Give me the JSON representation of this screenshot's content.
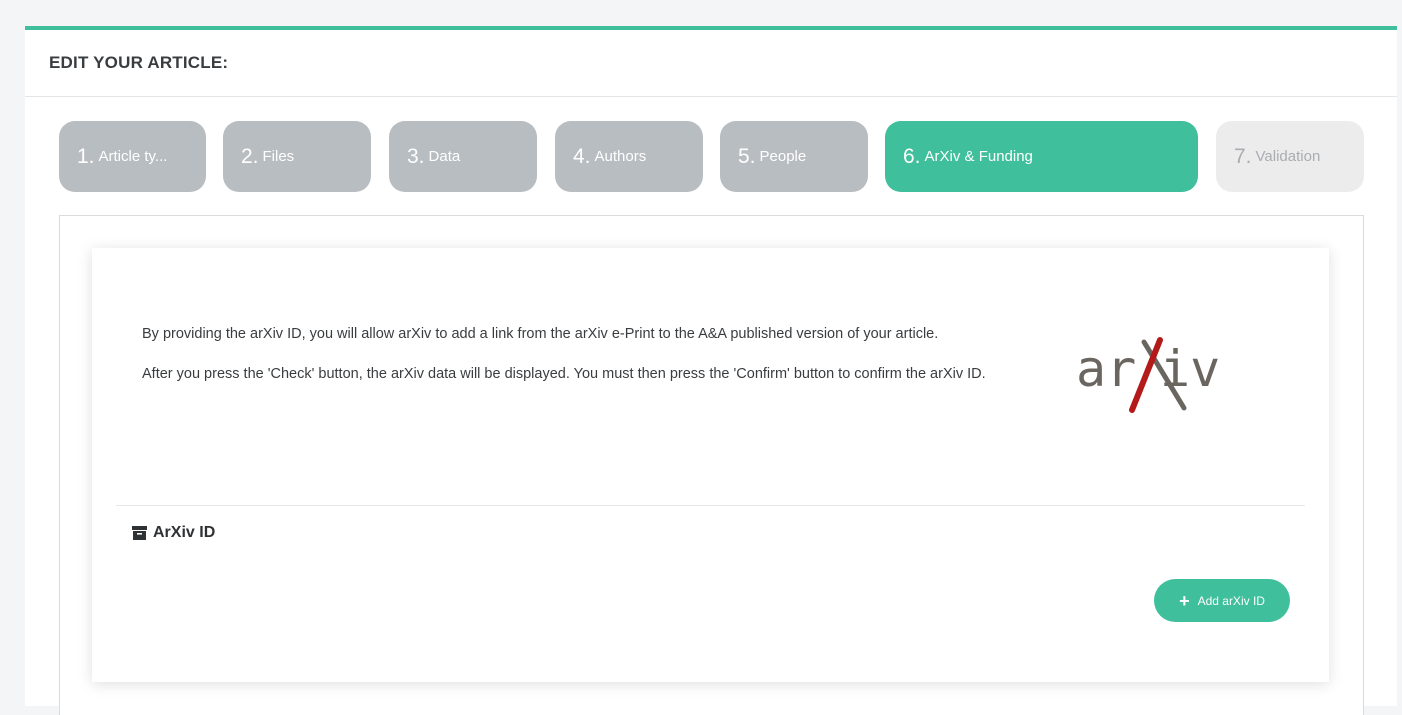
{
  "header": {
    "title": "EDIT YOUR ARTICLE:"
  },
  "steps": [
    {
      "num": "1.",
      "label": "Article ty...",
      "state": "inactive"
    },
    {
      "num": "2.",
      "label": "Files",
      "state": "inactive"
    },
    {
      "num": "3.",
      "label": "Data",
      "state": "inactive"
    },
    {
      "num": "4.",
      "label": "Authors",
      "state": "inactive"
    },
    {
      "num": "5.",
      "label": "People",
      "state": "inactive"
    },
    {
      "num": "6.",
      "label": "ArXiv & Funding",
      "state": "active"
    },
    {
      "num": "7.",
      "label": "Validation",
      "state": "disabled"
    }
  ],
  "content": {
    "paragraph1": "By providing the arXiv ID, you will allow arXiv to add a link from the arXiv e-Print to the A&A published version of your article.",
    "paragraph2": "After you press the 'Check' button, the arXiv data will be displayed. You must then press the 'Confirm' button to confirm the arXiv ID.",
    "logo_text": "arXiv",
    "section_title": "ArXiv ID",
    "section_icon": "archive-icon",
    "add_button_label": "Add arXiv ID",
    "add_button_icon": "plus-icon"
  },
  "colors": {
    "accent": "#3fbf9b",
    "step_inactive": "#b8bdc2",
    "step_disabled": "#ececec",
    "arxiv_red": "#b31b1b",
    "arxiv_gray": "#6b6560"
  }
}
